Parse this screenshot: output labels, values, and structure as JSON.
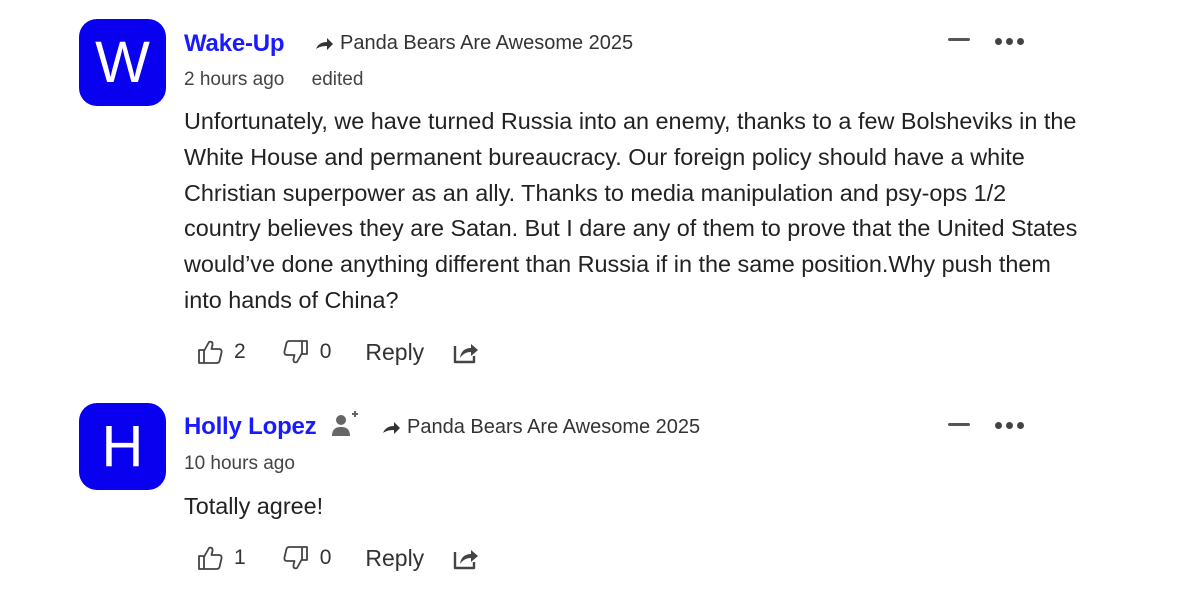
{
  "comments": [
    {
      "avatar_letter": "W",
      "author": "Wake-Up",
      "reply_to": "Panda Bears Are Awesome 2025",
      "time": "2 hours ago",
      "edited": "edited",
      "text": "Unfortunately, we have turned Russia into an enemy, thanks to a few Bolsheviks in the White House and permanent bureaucracy. Our foreign policy should have a white Christian superpower as an ally. Thanks to media manipulation and psy-ops 1/2 country believes they are Satan. But I dare any of them to prove that the United States would’ve done anything different than Russia if in the same position.Why push them into hands of China?",
      "likes": "2",
      "dislikes": "0",
      "reply_label": "Reply"
    },
    {
      "avatar_letter": "H",
      "author": "Holly Lopez",
      "reply_to": "Panda Bears Are Awesome 2025",
      "time": "10 hours ago",
      "text": "Totally agree!",
      "likes": "1",
      "dislikes": "0",
      "reply_label": "Reply"
    }
  ],
  "colors": {
    "avatar_bg": "#0a00f0",
    "author": "#1a1aff",
    "text": "#222222"
  }
}
